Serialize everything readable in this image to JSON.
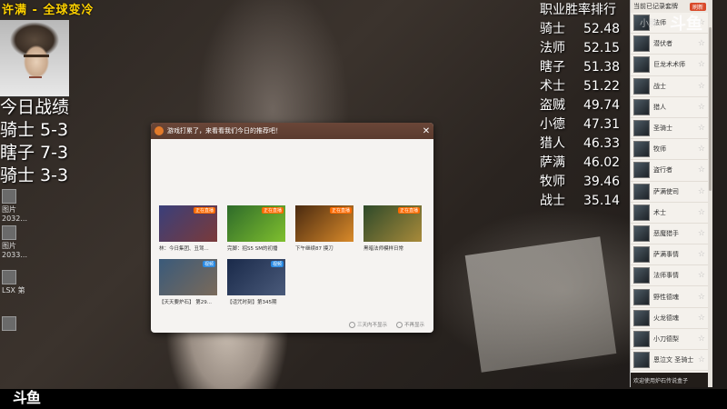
{
  "stream": {
    "title": "许满 - 全球变冷",
    "logo_text": "斗鱼"
  },
  "today": {
    "heading": "今日战绩",
    "rows": [
      "骑士 5-3",
      "瞎子 7-3",
      "骑士 3-3"
    ]
  },
  "desktop_icons": [
    {
      "label": "图片 2032..."
    },
    {
      "label": "图片 2033..."
    },
    {
      "label": "LSX 第"
    },
    {
      "label": ""
    }
  ],
  "winrate": {
    "title": "职业胜率排行",
    "rows": [
      {
        "cls": "骑士",
        "val": "52.48"
      },
      {
        "cls": "法师",
        "val": "52.15"
      },
      {
        "cls": "瞎子",
        "val": "51.38"
      },
      {
        "cls": "术士",
        "val": "51.22"
      },
      {
        "cls": "盗贼",
        "val": "49.74"
      },
      {
        "cls": "小德",
        "val": "47.31"
      },
      {
        "cls": "猎人",
        "val": "46.33"
      },
      {
        "cls": "萨满",
        "val": "46.02"
      },
      {
        "cls": "牧师",
        "val": "39.46"
      },
      {
        "cls": "战士",
        "val": "35.14"
      }
    ]
  },
  "deck_panel": {
    "header": "当前已记录套牌",
    "refresh": "刷新",
    "items": [
      "法师",
      "潜伏者",
      "巨龙术术师",
      "战士",
      "猎人",
      "圣骑士",
      "牧师",
      "盗行者",
      "萨满使司",
      "术士",
      "恶魔猎手",
      "萨满事情",
      "法师事情",
      "野性德魂",
      "火龙德魂",
      "小刀德梨",
      "恩泣文 圣骑士"
    ],
    "footer": "欢迎使用炉石传说盒子"
  },
  "overlay": {
    "marquee": "小胖"
  },
  "popup": {
    "title": "游戏打累了，来看看我们今日的推荐吧！",
    "close": "✕",
    "cards": [
      {
        "tag": "正在直播",
        "tag_type": "live",
        "caption": "林：今日集团、丑驾..."
      },
      {
        "tag": "正在直播",
        "tag_type": "live",
        "caption": "完脚：招S5 SM的初播"
      },
      {
        "tag": "正在直播",
        "tag_type": "live",
        "caption": "下午继续87 摸刀"
      },
      {
        "tag": "正在直播",
        "tag_type": "live",
        "caption": "黑暗法师模样日常"
      },
      {
        "tag": "视频",
        "tag_type": "video",
        "caption": "【天天要炉石】 第29..."
      },
      {
        "tag": "视频",
        "tag_type": "video",
        "caption": "【诅咒时刻】第345期"
      }
    ],
    "opt1": "三天内不显示",
    "opt2": "不再显示"
  }
}
